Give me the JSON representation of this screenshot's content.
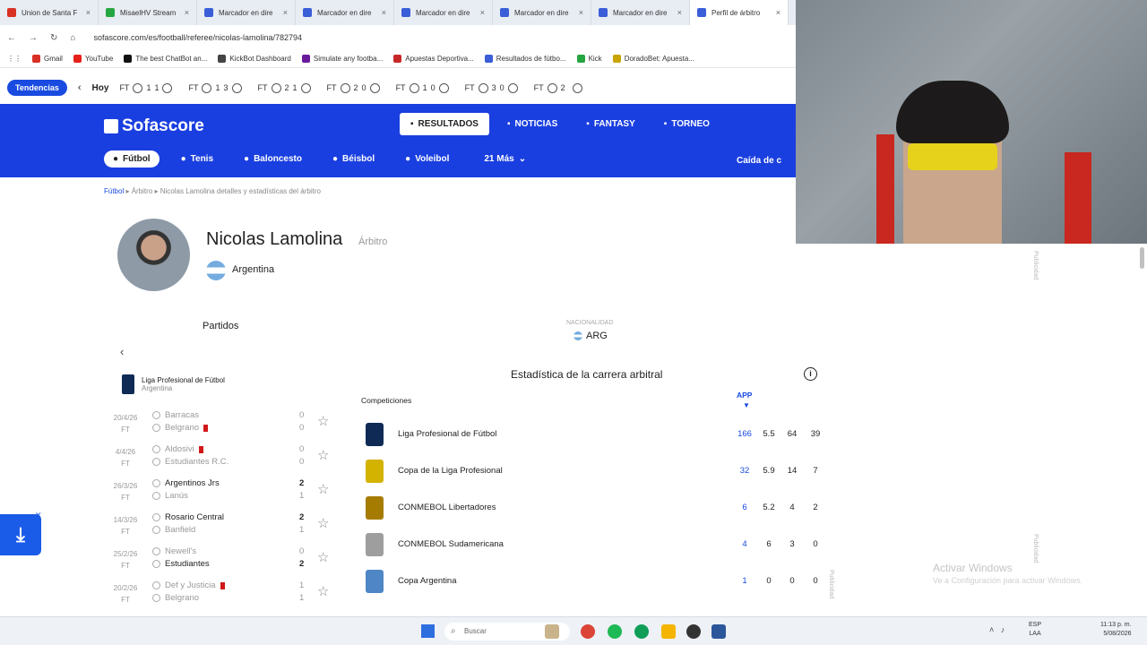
{
  "browser": {
    "tabs": [
      {
        "title": "Union de Santa F",
        "color": "#d93025",
        "active": false
      },
      {
        "title": "MisaelHV Stream",
        "color": "#26a641",
        "active": false
      },
      {
        "title": "Marcador en dire",
        "color": "#3a5ed8",
        "active": false
      },
      {
        "title": "Marcador en dire",
        "color": "#3a5ed8",
        "active": false
      },
      {
        "title": "Marcador en dire",
        "color": "#3a5ed8",
        "active": false
      },
      {
        "title": "Marcador en dire",
        "color": "#3a5ed8",
        "active": false
      },
      {
        "title": "Marcador en dire",
        "color": "#3a5ed8",
        "active": false
      },
      {
        "title": "Perfil de árbitro",
        "color": "#3a5ed8",
        "active": true
      }
    ],
    "url": "sofascore.com/es/football/referee/nicolas-lamolina/782794",
    "bookmarks": [
      {
        "label": "Gmail",
        "color": "#d93025"
      },
      {
        "label": "YouTube",
        "color": "#e62117"
      },
      {
        "label": "The best ChatBot an...",
        "color": "#111111"
      },
      {
        "label": "KickBot Dashboard",
        "color": "#444444"
      },
      {
        "label": "Simulate any footba...",
        "color": "#6a1b9a"
      },
      {
        "label": "Apuestas Deportiva...",
        "color": "#c62828"
      },
      {
        "label": "Resultados de fútbo...",
        "color": "#3a5ed8"
      },
      {
        "label": "Kick",
        "color": "#26a641"
      },
      {
        "label": "DoradoBet: Apuesta...",
        "color": "#c8a400"
      }
    ]
  },
  "trending": {
    "label": "Tendencias",
    "today": "Hoy",
    "matches": [
      {
        "status": "FT",
        "s1": "1",
        "s2": "1"
      },
      {
        "status": "FT",
        "s1": "1",
        "s2": "3"
      },
      {
        "status": "FT",
        "s1": "2",
        "s2": "1"
      },
      {
        "status": "FT",
        "s1": "2",
        "s2": "0"
      },
      {
        "status": "FT",
        "s1": "1",
        "s2": "0"
      },
      {
        "status": "FT",
        "s1": "3",
        "s2": "0"
      },
      {
        "status": "FT",
        "s1": "2",
        "s2": ""
      }
    ]
  },
  "header": {
    "logo": "Sofascore",
    "nav": [
      {
        "label": "RESULTADOS",
        "active": true
      },
      {
        "label": "NOTICIAS",
        "active": false
      },
      {
        "label": "FANTASY",
        "active": false
      },
      {
        "label": "TORNEO",
        "active": false
      }
    ],
    "sports": [
      {
        "label": "Fútbol",
        "active": true
      },
      {
        "label": "Tenis",
        "active": false
      },
      {
        "label": "Baloncesto",
        "active": false
      },
      {
        "label": "Béisbol",
        "active": false
      },
      {
        "label": "Voleibol",
        "active": false
      },
      {
        "label": "21  Más",
        "active": false
      }
    ],
    "right_link": "Caída de c"
  },
  "breadcrumb": {
    "items": [
      "Fútbol",
      "Árbitro",
      "Nicolas Lamolina detalles y estadísticas del árbitro"
    ]
  },
  "referee": {
    "name": "Nicolas Lamolina",
    "role": "Árbitro",
    "country": "Argentina",
    "nationality_label": "NACIONALIDAD",
    "nationality_code": "ARG"
  },
  "matches_panel": {
    "title": "Partidos",
    "league": "Liga Profesional de Fútbol",
    "league_country": "Argentina",
    "rows": [
      {
        "date": "20/4/26",
        "status": "FT",
        "home": "Barracas",
        "away": "Belgrano",
        "hs": "0",
        "as": "0",
        "home_bold": false,
        "away_bold": false,
        "home_red": false,
        "away_red": true
      },
      {
        "date": "4/4/26",
        "status": "FT",
        "home": "Aldosivi",
        "away": "Estudiantes R.C.",
        "hs": "0",
        "as": "0",
        "home_bold": false,
        "away_bold": false,
        "home_red": true,
        "away_red": false
      },
      {
        "date": "26/3/26",
        "status": "FT",
        "home": "Argentinos Jrs",
        "away": "Lanús",
        "hs": "2",
        "as": "1",
        "home_bold": true,
        "away_bold": false,
        "home_red": false,
        "away_red": false
      },
      {
        "date": "14/3/26",
        "status": "FT",
        "home": "Rosario Central",
        "away": "Banfield",
        "hs": "2",
        "as": "1",
        "home_bold": true,
        "away_bold": false,
        "home_red": false,
        "away_red": false
      },
      {
        "date": "25/2/26",
        "status": "FT",
        "home": "Newell's",
        "away": "Estudiantes",
        "hs": "0",
        "as": "2",
        "home_bold": false,
        "away_bold": true,
        "home_red": false,
        "away_red": false
      },
      {
        "date": "20/2/26",
        "status": "FT",
        "home": "Def y Justicia",
        "away": "Belgrano",
        "hs": "1",
        "as": "1",
        "home_bold": false,
        "away_bold": false,
        "home_red": true,
        "away_red": false
      }
    ]
  },
  "stats": {
    "title": "Estadística de la carrera arbitral",
    "competitions_label": "Competiciones",
    "app_label": "APP",
    "rows": [
      {
        "name": "Liga Profesional de Fútbol",
        "app": "166",
        "avg": "5.5",
        "v3": "64",
        "v4": "39",
        "color": "#0e2a55"
      },
      {
        "name": "Copa de la Liga Profesional",
        "app": "32",
        "avg": "5.9",
        "v3": "14",
        "v4": "7",
        "color": "#d4b200"
      },
      {
        "name": "CONMEBOL Libertadores",
        "app": "6",
        "avg": "5.2",
        "v3": "4",
        "v4": "2",
        "color": "#a67c00"
      },
      {
        "name": "CONMEBOL Sudamericana",
        "app": "4",
        "avg": "6",
        "v3": "3",
        "v4": "0",
        "color": "#9e9e9e"
      },
      {
        "name": "Copa Argentina",
        "app": "1",
        "avg": "0",
        "v3": "0",
        "v4": "0",
        "color": "#4f86c6"
      }
    ]
  },
  "ads": {
    "label": "Publicidad"
  },
  "watermark": {
    "line1": "Activar Windows",
    "line2": "Ve a Configuración para activar Windows."
  },
  "taskbar": {
    "search_placeholder": "Buscar",
    "lang1": "ESP",
    "lang2": "LAA",
    "time": "11:13 p. m.",
    "date": "5/08/2026"
  }
}
